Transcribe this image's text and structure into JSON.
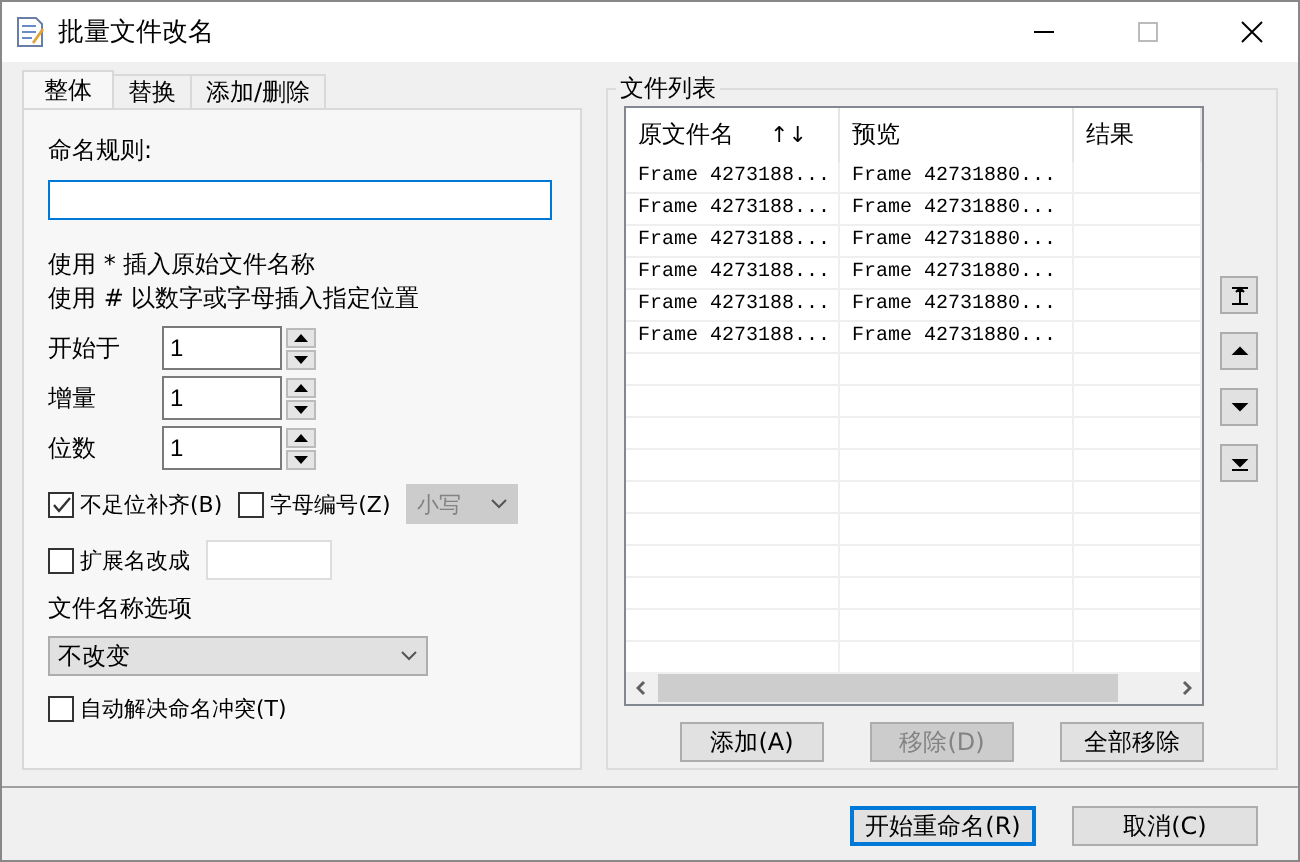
{
  "window": {
    "title": "批量文件改名"
  },
  "tabs": [
    {
      "label": "整体",
      "selected": true
    },
    {
      "label": "替换",
      "selected": false
    },
    {
      "label": "添加/删除",
      "selected": false
    }
  ],
  "naming_rule": {
    "label": "命名规则:"
  },
  "hints": [
    "使用 * 插入原始文件名称",
    "使用 # 以数字或字母插入指定位置"
  ],
  "spinners": [
    {
      "label": "开始于",
      "value": "1"
    },
    {
      "label": "增量",
      "value": "1"
    },
    {
      "label": "位数",
      "value": "1"
    }
  ],
  "pad_zeros": {
    "label": "不足位补齐(B)",
    "checked": true
  },
  "letter_numbering": {
    "label": "字母编号(Z)",
    "checked": false
  },
  "case_select": {
    "value": "小写",
    "disabled": true
  },
  "extension": {
    "label": "扩展名改成",
    "checked": false
  },
  "name_options": {
    "label": "文件名称选项",
    "value": "不改变"
  },
  "auto_resolve": {
    "label": "自动解决命名冲突(T)",
    "checked": false
  },
  "file_list": {
    "title": "文件列表",
    "columns": [
      "原文件名",
      "预览",
      "结果"
    ],
    "sort_arrows": "↑↓",
    "rows": [
      {
        "original": "Frame 4273188...",
        "preview": "Frame 42731880..."
      },
      {
        "original": "Frame 4273188...",
        "preview": "Frame 42731880..."
      },
      {
        "original": "Frame 4273188...",
        "preview": "Frame 42731880..."
      },
      {
        "original": "Frame 4273188...",
        "preview": "Frame 42731880..."
      },
      {
        "original": "Frame 4273188...",
        "preview": "Frame 42731880..."
      },
      {
        "original": "Frame 4273188...",
        "preview": "Frame 42731880..."
      }
    ]
  },
  "list_buttons": [
    {
      "label": "添加(A)",
      "disabled": false
    },
    {
      "label": "移除(D)",
      "disabled": true
    },
    {
      "label": "全部移除",
      "disabled": false
    }
  ],
  "footer_buttons": [
    {
      "label": "开始重命名(R)",
      "focused": true
    },
    {
      "label": "取消(C)",
      "focused": false
    }
  ]
}
